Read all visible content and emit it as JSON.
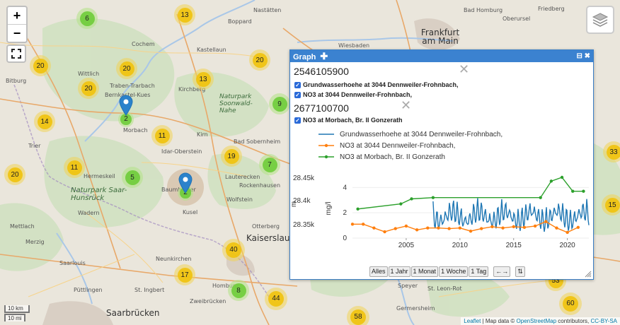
{
  "map": {
    "towns": [
      {
        "name": "Cochem"
      },
      {
        "name": "Boppard"
      },
      {
        "name": "Nastätten"
      },
      {
        "name": "Bad Homburg"
      },
      {
        "name": "Friedberg"
      },
      {
        "name": "Oberursel"
      },
      {
        "name": "Frankfurt am Main"
      },
      {
        "name": "Wiesbaden"
      },
      {
        "name": "Wittlich"
      },
      {
        "name": "Kastellaun"
      },
      {
        "name": "Bitburg"
      },
      {
        "name": "Traben-Trarbach"
      },
      {
        "name": "Bernkastel-Kues"
      },
      {
        "name": "Kirchberg"
      },
      {
        "name": "Morbach"
      },
      {
        "name": "Trier"
      },
      {
        "name": "Idar-Oberstein"
      },
      {
        "name": "Hermeskeil"
      },
      {
        "name": "Baumholder"
      },
      {
        "name": "Kusel"
      },
      {
        "name": "Lauterecken"
      },
      {
        "name": "Rockenhausen"
      },
      {
        "name": "Wolfstein"
      },
      {
        "name": "Wadern"
      },
      {
        "name": "Merzig"
      },
      {
        "name": "Saarlouis"
      },
      {
        "name": "Neunkirchen"
      },
      {
        "name": "Homburg"
      },
      {
        "name": "Kaiserslautern"
      },
      {
        "name": "Otterberg"
      },
      {
        "name": "Püttlingen"
      },
      {
        "name": "St. Ingbert"
      },
      {
        "name": "Saarbrücken"
      },
      {
        "name": "Speyer"
      },
      {
        "name": "St. Leon-Rot"
      },
      {
        "name": "Kirn"
      },
      {
        "name": "Bad Sobernheim"
      },
      {
        "name": "Mettlach"
      },
      {
        "name": "Zweibrücken"
      },
      {
        "name": "Germersheim"
      }
    ],
    "parks": [
      {
        "name": "Naturpark Soonwald-Nahe"
      },
      {
        "name": "Naturpark Saar-Hunsrück"
      }
    ],
    "clusters": [
      {
        "count": "6",
        "color": "green"
      },
      {
        "count": "13",
        "color": "yellow"
      },
      {
        "count": "20",
        "color": "yellow"
      },
      {
        "count": "20",
        "color": "yellow"
      },
      {
        "count": "20",
        "color": "yellow"
      },
      {
        "count": "13",
        "color": "yellow"
      },
      {
        "count": "20",
        "color": "yellow"
      },
      {
        "count": "9",
        "color": "green"
      },
      {
        "count": "14",
        "color": "yellow"
      },
      {
        "count": "11",
        "color": "yellow"
      },
      {
        "count": "11",
        "color": "yellow"
      },
      {
        "count": "19",
        "color": "yellow"
      },
      {
        "count": "20",
        "color": "yellow"
      },
      {
        "count": "5",
        "color": "green"
      },
      {
        "count": "7",
        "color": "green"
      },
      {
        "count": "40",
        "color": "yellow"
      },
      {
        "count": "17",
        "color": "yellow"
      },
      {
        "count": "8",
        "color": "green"
      },
      {
        "count": "44",
        "color": "yellow"
      },
      {
        "count": "58",
        "color": "yellow"
      },
      {
        "count": "33",
        "color": "yellow"
      },
      {
        "count": "15",
        "color": "yellow"
      },
      {
        "count": "53",
        "color": "yellow"
      },
      {
        "count": "60",
        "color": "yellow"
      }
    ],
    "markers": [
      {
        "count": "2"
      },
      {
        "count": "2"
      }
    ],
    "scale": {
      "km": "10 km",
      "mi": "10 mi"
    },
    "attribution": {
      "leaflet": "Leaflet",
      "sep": " | Map data © ",
      "osm": "OpenStreetMap",
      "contrib": " contributors, ",
      "license": "CC-BY-SA"
    }
  },
  "controls": {
    "zoom_in": "+",
    "zoom_out": "−"
  },
  "graph": {
    "title": "Graph",
    "stations": [
      {
        "id": "2546105900",
        "checks": [
          "Grundwasserhoehe at 3044 Dennweiler-Frohnbach,",
          "NO3 at 3044 Dennweiler-Frohnbach,"
        ]
      },
      {
        "id": "2677100700",
        "checks": [
          "NO3 at Morbach, Br. II Gonzerath"
        ]
      }
    ],
    "range_buttons": [
      "Alles",
      "1 Jahr",
      "1 Monat",
      "1 Woche",
      "1 Tag",
      "←→",
      "⇅"
    ]
  },
  "chart_data": {
    "type": "line",
    "legend": [
      "Grundwasserhoehe at 3044 Dennweiler-Frohnbach,",
      "NO3 at 3044 Dennweiler-Frohnbach,",
      "NO3 at Morbach, Br. II Gonzerath"
    ],
    "colors": [
      "#1f77b4",
      "#ff7f0e",
      "#2ca02c"
    ],
    "xticks": [
      "2005",
      "2010",
      "2015",
      "2020"
    ],
    "xlim": [
      2000,
      2022
    ],
    "left_axis": {
      "label": "m",
      "ticks": [
        "28.45k",
        "28.4k",
        "28.35k"
      ]
    },
    "right_axis": {
      "label": "mg/l",
      "ticks": [
        "4",
        "2",
        "0"
      ],
      "ylim": [
        0,
        4.8
      ]
    },
    "series": [
      {
        "name": "NO3 at Morbach, Br. II Gonzerath",
        "axis": "right",
        "x": [
          2000.5,
          2004.5,
          2005.5,
          2007.5,
          2017.5,
          2018.5,
          2019.5,
          2020.5,
          2021.5
        ],
        "y": [
          2.3,
          2.7,
          3.1,
          3.2,
          3.2,
          4.5,
          4.8,
          3.7,
          3.7
        ]
      },
      {
        "name": "NO3 at 3044 Dennweiler-Frohnbach,",
        "axis": "right",
        "x": [
          2000,
          2001,
          2002,
          2003,
          2004,
          2005,
          2006,
          2007,
          2008,
          2009,
          2010,
          2011,
          2012,
          2013,
          2014,
          2015,
          2016,
          2017,
          2018,
          2019,
          2020,
          2021
        ],
        "y": [
          1.1,
          1.1,
          0.8,
          0.5,
          0.75,
          0.95,
          0.65,
          0.8,
          0.8,
          0.75,
          0.8,
          0.55,
          0.75,
          0.9,
          0.8,
          0.9,
          0.85,
          0.95,
          1.3,
          0.8,
          0.45,
          0.85
        ]
      }
    ]
  }
}
